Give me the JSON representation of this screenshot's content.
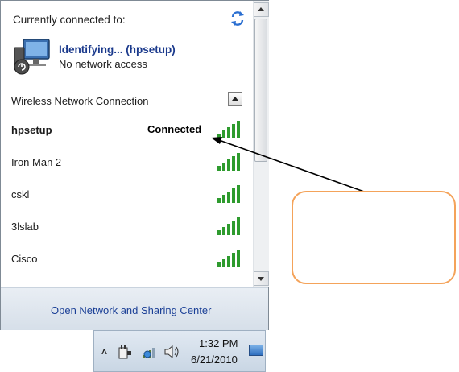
{
  "flyout": {
    "header": "Currently connected to:",
    "current_network": {
      "name": "Identifying... (hpsetup)",
      "status": "No network access",
      "icon": "network-computer-icon"
    },
    "refresh_icon": "refresh-arrows-icon",
    "group": {
      "title": "Wireless Network Connection",
      "collapse_icon": "collapse-up-icon"
    },
    "networks": [
      {
        "name": "hpsetup",
        "status": "Connected",
        "bold": true
      },
      {
        "name": "Iron Man 2",
        "status": "",
        "bold": false
      },
      {
        "name": "cskl",
        "status": "",
        "bold": false
      },
      {
        "name": "3lslab",
        "status": "",
        "bold": false
      },
      {
        "name": "Cisco",
        "status": "",
        "bold": false
      }
    ],
    "footer_link": "Open Network and Sharing Center"
  },
  "taskbar": {
    "show_hidden_icon": "˄",
    "time": "1:32 PM",
    "date": "6/21/2010",
    "icons": [
      "power-plug-icon",
      "network-icon",
      "speaker-icon"
    ]
  },
  "colors": {
    "signal_green": "#2e9b2e",
    "link_blue": "#1a3f96",
    "callout_orange": "#f4a35a"
  }
}
